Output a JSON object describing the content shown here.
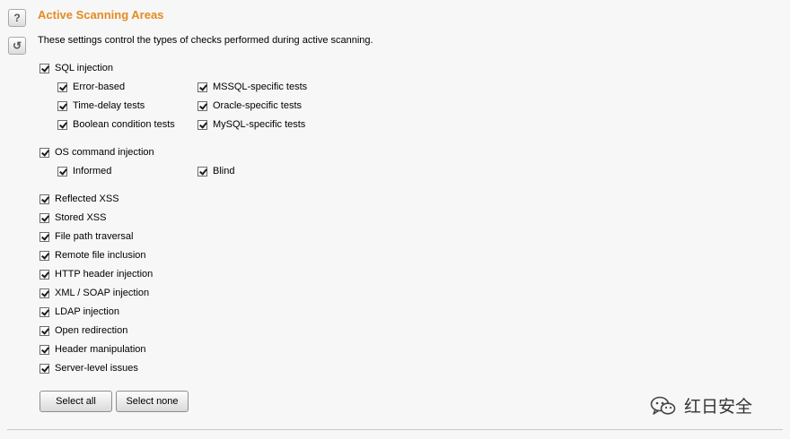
{
  "header": {
    "title": "Active Scanning Areas",
    "description": "These settings control the types of checks performed during active scanning."
  },
  "side_buttons": {
    "help_glyph": "?",
    "reset_glyph": "↺"
  },
  "groups": {
    "sql": {
      "label": "SQL injection",
      "checked": true,
      "error_based": "Error-based",
      "time_delay": "Time-delay tests",
      "boolean": "Boolean condition tests",
      "mssql": "MSSQL-specific tests",
      "oracle": "Oracle-specific tests",
      "mysql": "MySQL-specific tests"
    },
    "os": {
      "label": "OS command injection",
      "checked": true,
      "informed": "Informed",
      "blind": "Blind"
    }
  },
  "checks": {
    "reflected_xss": "Reflected XSS",
    "stored_xss": "Stored XSS",
    "file_path": "File path traversal",
    "remote_file": "Remote file inclusion",
    "http_header": "HTTP header injection",
    "xml_soap": "XML / SOAP injection",
    "ldap": "LDAP injection",
    "open_redirect": "Open redirection",
    "header_manip": "Header manipulation",
    "server_level": "Server-level issues"
  },
  "buttons": {
    "select_all": "Select all",
    "select_none": "Select none"
  },
  "watermark": {
    "text": "红日安全",
    "icon": "wechat-icon"
  },
  "colors": {
    "title": "#e58a1e",
    "background": "#f7f7f7"
  }
}
